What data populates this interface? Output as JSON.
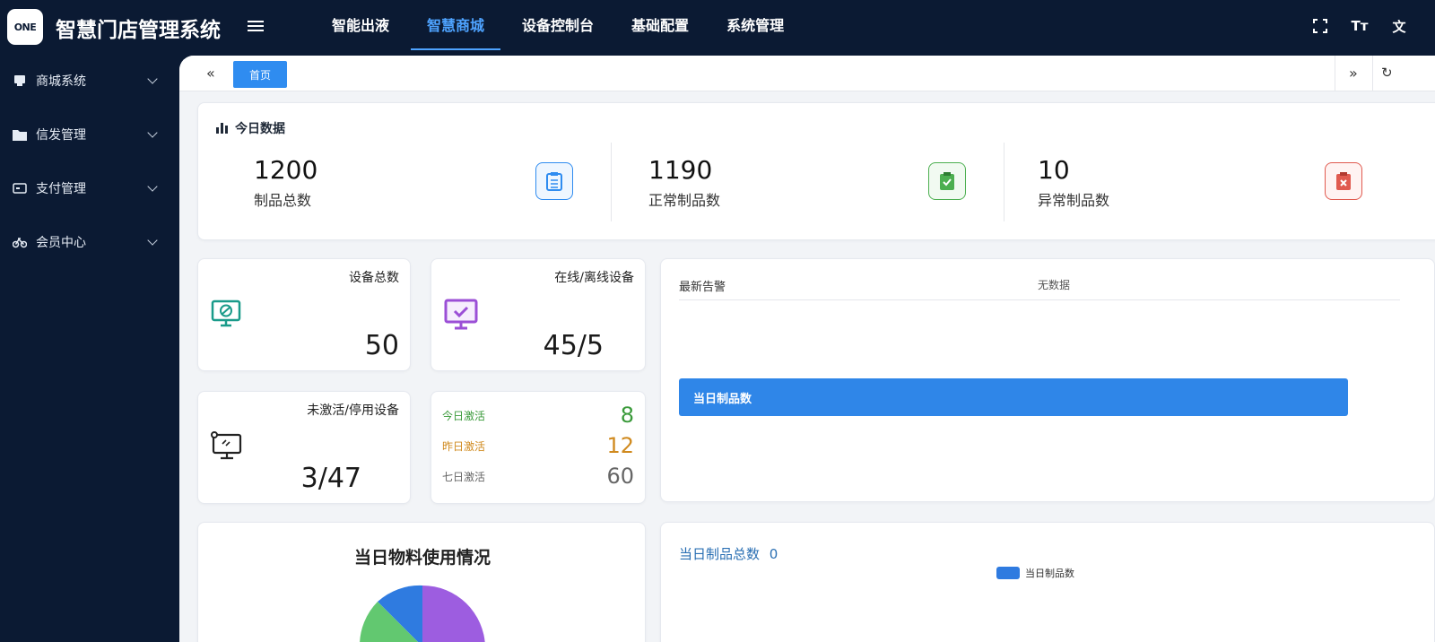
{
  "app": {
    "logo_text": "ONE",
    "title": "智慧门店管理系统"
  },
  "top_nav": [
    {
      "label": "智能出液",
      "active": false
    },
    {
      "label": "智慧商城",
      "active": true
    },
    {
      "label": "设备控制台",
      "active": false
    },
    {
      "label": "基础配置",
      "active": false
    },
    {
      "label": "系统管理",
      "active": false
    }
  ],
  "top_icons": {
    "fullscreen": "fullscreen-icon",
    "font": "Tт",
    "translate": "文"
  },
  "sidebar": {
    "items": [
      {
        "label": "商城系统",
        "icon": "shop-icon"
      },
      {
        "label": "信发管理",
        "icon": "folder-icon"
      },
      {
        "label": "支付管理",
        "icon": "wallet-icon"
      },
      {
        "label": "会员中心",
        "icon": "bike-icon"
      }
    ]
  },
  "tabs": {
    "home": "首页"
  },
  "today": {
    "title": "今日数据",
    "stats": [
      {
        "value": "1200",
        "label": "制品总数",
        "color": "#2f8cf0"
      },
      {
        "value": "1190",
        "label": "正常制品数",
        "color": "#4caf50"
      },
      {
        "value": "10",
        "label": "异常制品数",
        "color": "#e05a4f"
      }
    ]
  },
  "devices": {
    "total": {
      "title": "设备总数",
      "value": "50"
    },
    "online": {
      "title": "在线/离线设备",
      "value": "45/5"
    },
    "inactive": {
      "title": "未激活/停用设备",
      "value": "3/47"
    },
    "activation": [
      {
        "label": "今日激活",
        "value": "8",
        "color": "#3a9a3a"
      },
      {
        "label": "昨日激活",
        "value": "12",
        "color": "#d08a1e"
      },
      {
        "label": "七日激活",
        "value": "60",
        "color": "#666666"
      }
    ]
  },
  "alerts": {
    "title": "最新告警",
    "empty": "无数据",
    "bar_label": "当日制品数"
  },
  "material": {
    "title": "当日物料使用情况"
  },
  "production": {
    "title": "当日制品总数",
    "count": "0",
    "legend": "当日制品数"
  }
}
